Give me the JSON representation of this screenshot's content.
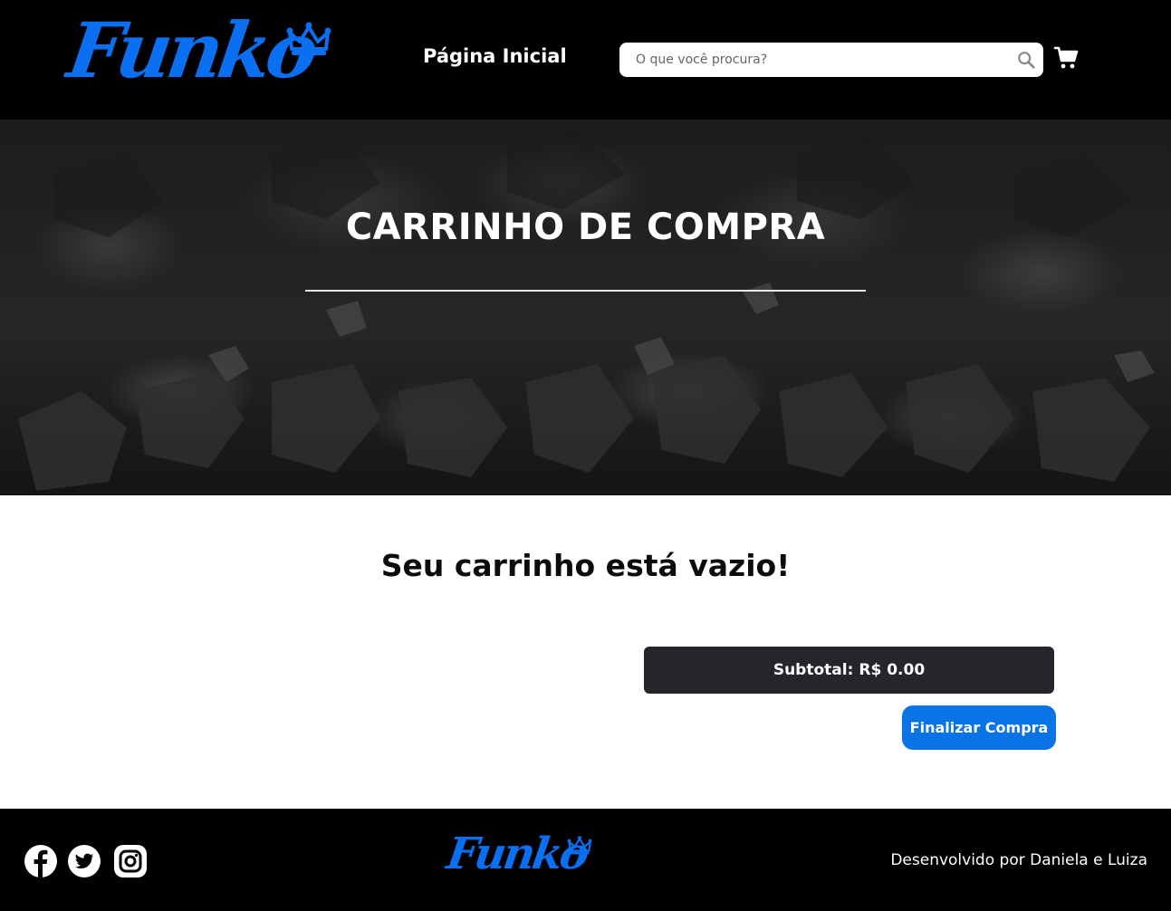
{
  "header": {
    "logo_text": "Funko",
    "nav_home": "Página Inicial",
    "search_placeholder": "O que você procura?"
  },
  "hero": {
    "title": "CARRINHO DE COMPRA"
  },
  "cart": {
    "empty_message": "Seu carrinho está vazio!",
    "subtotal_label": "Subtotal:",
    "subtotal_value": "R$ 0.00",
    "checkout_label": "Finalizar Compra"
  },
  "footer": {
    "logo_text": "Funko",
    "credit": "Desenvolvido por Daniela e Luiza",
    "social": [
      "facebook-icon",
      "twitter-icon",
      "instagram-icon"
    ]
  },
  "colors": {
    "brand_blue": "#0a6ff0",
    "button_blue": "#0a74e6",
    "subtotal_bg": "#26252b",
    "header_bg": "#000000"
  }
}
